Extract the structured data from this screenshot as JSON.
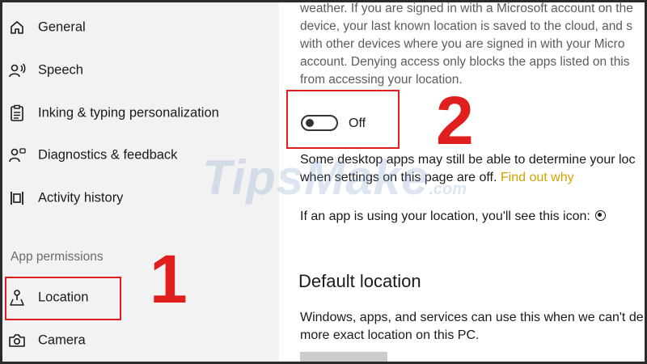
{
  "sidebar": {
    "items": [
      {
        "label": "General",
        "icon": "home-icon"
      },
      {
        "label": "Speech",
        "icon": "speech-icon"
      },
      {
        "label": "Inking & typing personalization",
        "icon": "clipboard-icon"
      },
      {
        "label": "Diagnostics & feedback",
        "icon": "feedback-icon"
      },
      {
        "label": "Activity history",
        "icon": "activity-icon"
      }
    ],
    "section_header": "App permissions",
    "permissions": [
      {
        "label": "Location",
        "icon": "location-icon"
      },
      {
        "label": "Camera",
        "icon": "camera-icon"
      }
    ]
  },
  "main": {
    "description_lines": [
      "weather. If you are signed in with a Microsoft account on the",
      "device, your last known location is saved to the cloud, and s",
      "with other devices where you are signed in with your Micro",
      "account. Denying access only blocks the apps listed on this",
      "from accessing your location."
    ],
    "toggle_label": "Off",
    "desktop_line1": "Some desktop apps may still be able to determine your loc",
    "desktop_line2": "when settings on this page are off.",
    "find_out_why": "Find out why",
    "icon_line": "If an app is using your location, you'll see this icon:",
    "default_location_heading": "Default location",
    "default_line1": "Windows, apps, and services can use this when we can't de",
    "default_line2": "more exact location on this PC."
  },
  "annotations": {
    "step1": "1",
    "step2": "2",
    "highlight_color": "#e01e1e"
  },
  "watermark": {
    "main": "TipsMake",
    "sub": ".com"
  }
}
